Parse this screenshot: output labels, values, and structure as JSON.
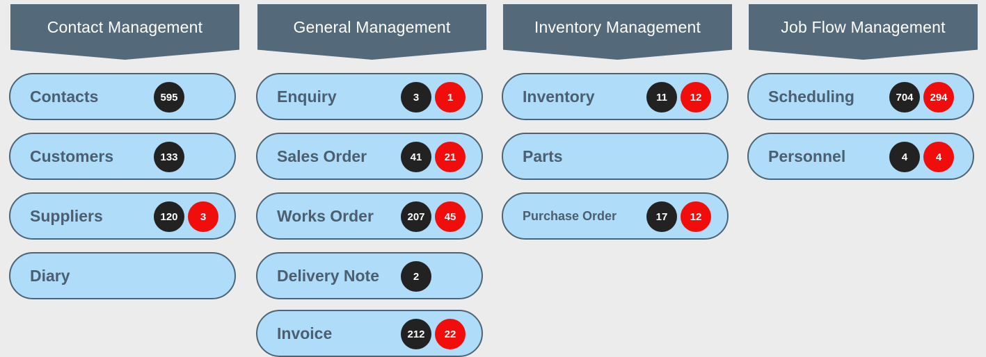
{
  "colors": {
    "background": "#ececec",
    "header": "#546a7b",
    "module_fill": "#aedcf9",
    "module_border": "#4d6475",
    "label_text": "#4b5f70",
    "badge_count": "#222222",
    "badge_alert": "#f20d0d"
  },
  "columns": [
    {
      "title": "Contact Management",
      "modules": [
        {
          "label": "Contacts",
          "count": "595"
        },
        {
          "label": "Customers",
          "count": "133"
        },
        {
          "label": "Suppliers",
          "count": "120",
          "alert": "3"
        },
        {
          "label": "Diary"
        }
      ]
    },
    {
      "title": "General Management",
      "modules": [
        {
          "label": "Enquiry",
          "count": "3",
          "alert": "1"
        },
        {
          "label": "Sales Order",
          "count": "41",
          "alert": "21"
        },
        {
          "label": "Works Order",
          "count": "207",
          "alert": "45"
        },
        {
          "label": "Delivery Note",
          "count": "2"
        },
        {
          "label": "Invoice",
          "count": "212",
          "alert": "22"
        }
      ]
    },
    {
      "title": "Inventory Management",
      "modules": [
        {
          "label": "Inventory",
          "count": "11",
          "alert": "12"
        },
        {
          "label": "Parts"
        },
        {
          "label": "Purchase Order",
          "count": "17",
          "alert": "12"
        }
      ]
    },
    {
      "title": "Job Flow Management",
      "modules": [
        {
          "label": "Scheduling",
          "count": "704",
          "alert": "294"
        },
        {
          "label": "Personnel",
          "count": "4",
          "alert": "4"
        }
      ]
    }
  ]
}
